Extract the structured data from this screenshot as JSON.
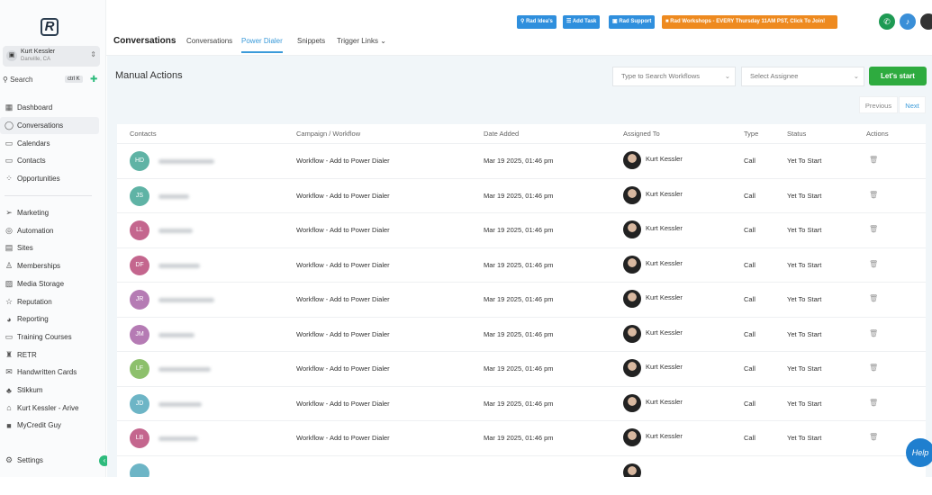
{
  "sidebar": {
    "logo": "R",
    "account": {
      "name": "Kurt Kessler",
      "location": "Danville, CA"
    },
    "search": "Search",
    "shortcut": "ctrl K",
    "items": [
      {
        "label": "Dashboard",
        "icon": "▦"
      },
      {
        "label": "Conversations",
        "icon": "◯"
      },
      {
        "label": "Calendars",
        "icon": "▭"
      },
      {
        "label": "Contacts",
        "icon": "▭"
      },
      {
        "label": "Opportunities",
        "icon": "⁘"
      },
      {
        "label": "Marketing",
        "icon": "➢"
      },
      {
        "label": "Automation",
        "icon": "◎"
      },
      {
        "label": "Sites",
        "icon": "▤"
      },
      {
        "label": "Memberships",
        "icon": "♙"
      },
      {
        "label": "Media Storage",
        "icon": "▨"
      },
      {
        "label": "Reputation",
        "icon": "☆"
      },
      {
        "label": "Reporting",
        "icon": "◕"
      },
      {
        "label": "Training Courses",
        "icon": "▭"
      },
      {
        "label": "RETR",
        "icon": "♜"
      },
      {
        "label": "Handwritten Cards",
        "icon": "✉"
      },
      {
        "label": "Stikkum",
        "icon": "♣"
      },
      {
        "label": "Kurt Kessler - Arive",
        "icon": "⌂"
      },
      {
        "label": "MyCredit Guy",
        "icon": "■"
      }
    ],
    "settings": "Settings"
  },
  "topbar": {
    "buttons": [
      {
        "label": "Rad Idea's",
        "color": "#2f8fdd"
      },
      {
        "label": "Add Task",
        "color": "#2f8fdd"
      },
      {
        "label": "Rad Support",
        "color": "#2f8fdd"
      },
      {
        "label": "Rad Workshops - EVERY Thursday 11AM PST, Click To Join!",
        "color": "#ee8a1f"
      }
    ],
    "title": "Conversations",
    "tabs": [
      "Conversations",
      "Power Dialer",
      "Snippets",
      "Trigger Links"
    ],
    "active_tab": "Power Dialer"
  },
  "main": {
    "heading": "Manual Actions",
    "workflow_placeholder": "Type to Search Workflows",
    "assignee_placeholder": "Select Assignee",
    "start": "Let's start",
    "previous": "Previous",
    "next": "Next",
    "columns": [
      "Contacts",
      "Campaign / Workflow",
      "Date Added",
      "Assigned To",
      "Type",
      "Status",
      "Actions"
    ],
    "rows": [
      {
        "initials": "HD",
        "color": "#5fb3a5",
        "workflow": "Workflow - Add to Power Dialer",
        "date": "Mar 19 2025, 01:46 pm",
        "assigned": "Kurt Kessler",
        "type": "Call",
        "status": "Yet To Start"
      },
      {
        "initials": "JS",
        "color": "#5fb3a5",
        "workflow": "Workflow - Add to Power Dialer",
        "date": "Mar 19 2025, 01:46 pm",
        "assigned": "Kurt Kessler",
        "type": "Call",
        "status": "Yet To Start"
      },
      {
        "initials": "LL",
        "color": "#c4668e",
        "workflow": "Workflow - Add to Power Dialer",
        "date": "Mar 19 2025, 01:46 pm",
        "assigned": "Kurt Kessler",
        "type": "Call",
        "status": "Yet To Start"
      },
      {
        "initials": "DF",
        "color": "#c4668e",
        "workflow": "Workflow - Add to Power Dialer",
        "date": "Mar 19 2025, 01:46 pm",
        "assigned": "Kurt Kessler",
        "type": "Call",
        "status": "Yet To Start"
      },
      {
        "initials": "JR",
        "color": "#b57bb4",
        "workflow": "Workflow - Add to Power Dialer",
        "date": "Mar 19 2025, 01:46 pm",
        "assigned": "Kurt Kessler",
        "type": "Call",
        "status": "Yet To Start"
      },
      {
        "initials": "JM",
        "color": "#b57bb4",
        "workflow": "Workflow - Add to Power Dialer",
        "date": "Mar 19 2025, 01:46 pm",
        "assigned": "Kurt Kessler",
        "type": "Call",
        "status": "Yet To Start"
      },
      {
        "initials": "LF",
        "color": "#8dc06c",
        "workflow": "Workflow - Add to Power Dialer",
        "date": "Mar 19 2025, 01:46 pm",
        "assigned": "Kurt Kessler",
        "type": "Call",
        "status": "Yet To Start"
      },
      {
        "initials": "JD",
        "color": "#6db5c6",
        "workflow": "Workflow - Add to Power Dialer",
        "date": "Mar 19 2025, 01:46 pm",
        "assigned": "Kurt Kessler",
        "type": "Call",
        "status": "Yet To Start"
      },
      {
        "initials": "LB",
        "color": "#c4668e",
        "workflow": "Workflow - Add to Power Dialer",
        "date": "Mar 19 2025, 01:46 pm",
        "assigned": "Kurt Kessler",
        "type": "Call",
        "status": "Yet To Start"
      }
    ]
  },
  "help": "Help"
}
